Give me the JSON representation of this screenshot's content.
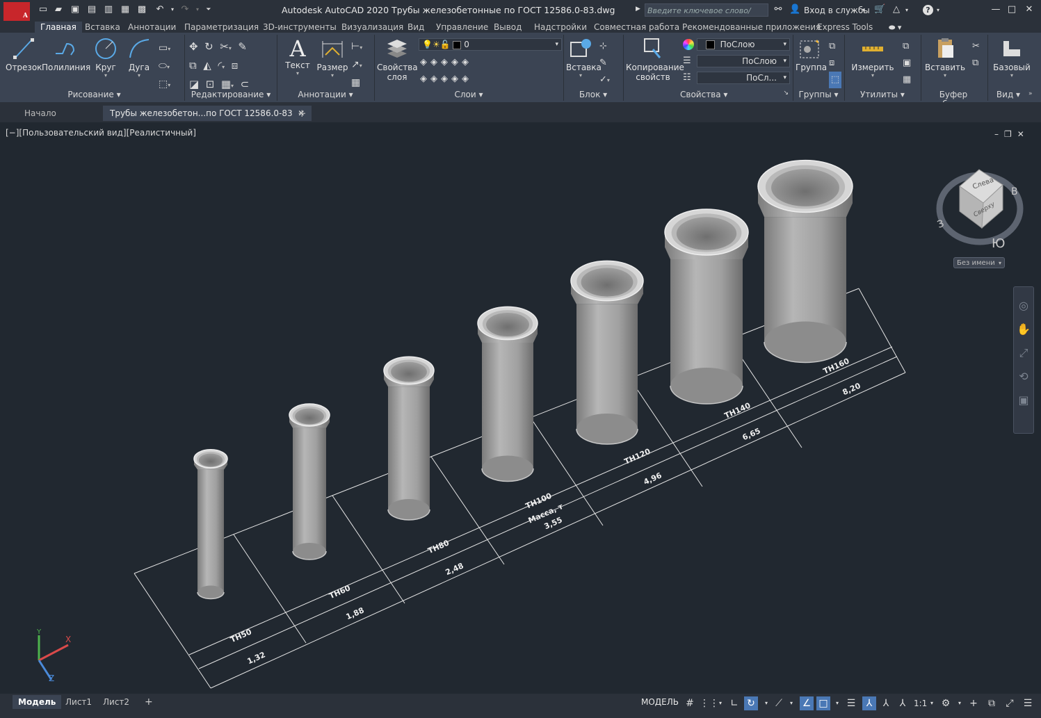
{
  "app": {
    "logo_letter": "A",
    "logo_sub": "",
    "title": "Autodesk AutoCAD 2020   Трубы железобетонные по ГОСТ 12586.0-83.dwg",
    "search_placeholder": "Введите ключевое слово/фразу",
    "signin": "Вход в службы",
    "help": "?"
  },
  "ribbon_tabs": [
    "Главная",
    "Вставка",
    "Аннотации",
    "Параметризация",
    "3D-инструменты",
    "Визуализация",
    "Вид",
    "Управление",
    "Вывод",
    "Надстройки",
    "Совместная работа",
    "Рекомендованные приложения",
    "Express Tools"
  ],
  "panels": {
    "draw": {
      "label": "Рисование",
      "line": "Отрезок",
      "polyline": "Полилиния",
      "circle": "Круг",
      "arc": "Дуга"
    },
    "modify": {
      "label": "Редактирование"
    },
    "annotation": {
      "label": "Аннотации",
      "text": "Текст",
      "dimension": "Размер"
    },
    "layers": {
      "label": "Слои",
      "props_l1": "Свойства",
      "props_l2": "слоя",
      "current_layer": "0"
    },
    "block": {
      "label": "Блок",
      "insert": "Вставка"
    },
    "properties": {
      "label": "Свойства",
      "copy_l1": "Копирование",
      "copy_l2": "свойств",
      "color": "ПоСлою",
      "linetype": "ПоСлою",
      "lineweight": "ПоСл..."
    },
    "groups": {
      "label": "Группы",
      "group": "Группа"
    },
    "utilities": {
      "label": "Утилиты",
      "measure": "Измерить"
    },
    "clipboard": {
      "label": "Буфер обмена",
      "paste": "Вставить"
    },
    "view": {
      "label": "Вид",
      "base": "Базовый"
    }
  },
  "doc_tabs": {
    "start": "Начало",
    "file": "Трубы железобетон...по ГОСТ 12586.0-83"
  },
  "viewport": {
    "label": "[−][Пользовательский вид][Реалистичный]"
  },
  "viewcube": {
    "face_top": "Сверху",
    "face_side": "Слева",
    "north": "В",
    "west": "З",
    "south": "Ю",
    "ucs_name": "Без имени"
  },
  "ucs": {
    "x": "X",
    "y": "Y",
    "z": "Z"
  },
  "table": {
    "header_label": "Масса, т",
    "columns": [
      {
        "name": "ТН50",
        "mass": "1,32"
      },
      {
        "name": "ТН60",
        "mass": "1,88"
      },
      {
        "name": "ТН80",
        "mass": "2,48"
      },
      {
        "name": "ТН100",
        "mass": "3,55"
      },
      {
        "name": "ТН120",
        "mass": "4,96"
      },
      {
        "name": "ТН140",
        "mass": "6,65"
      },
      {
        "name": "ТН160",
        "mass": "8,20"
      }
    ]
  },
  "layout_tabs": [
    "Модель",
    "Лист1",
    "Лист2"
  ],
  "status": {
    "model": "МОДЕЛЬ",
    "scale": "1:1"
  },
  "colors": {
    "accent": "#4a78b5",
    "logo": "#c8262b",
    "pipe": "#a9a9a9"
  }
}
